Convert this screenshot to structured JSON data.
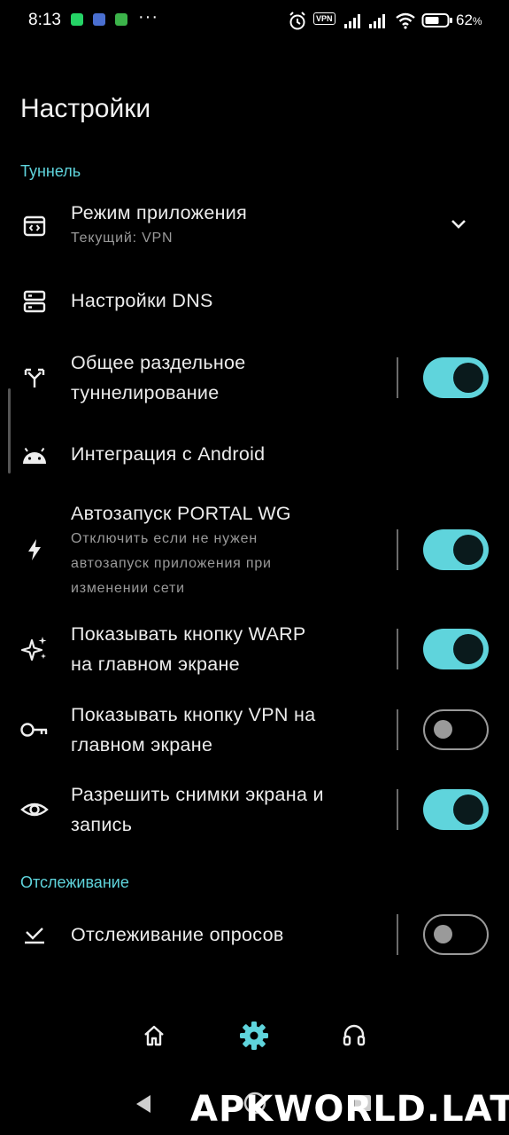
{
  "status_bar": {
    "time": "8:13",
    "battery_percent": "62",
    "battery_suffix": "%",
    "vpn_badge": "VPN",
    "more_dots": "···"
  },
  "page": {
    "title": "Настройки"
  },
  "sections": {
    "tunnel": {
      "header": "Туннель"
    },
    "tracking": {
      "header": "Отслеживание"
    }
  },
  "settings": {
    "app_mode": {
      "title": "Режим приложения",
      "subtitle": "Текущий: VPN",
      "icon": "app-window-icon"
    },
    "dns": {
      "title": "Настройки DNS",
      "icon": "dns-server-icon"
    },
    "split_tunnel": {
      "title_line1": "Общее раздельное",
      "title_line2": "туннелирование",
      "enabled": true,
      "icon": "split-arrows-icon"
    },
    "android": {
      "title": "Интеграция с Android",
      "icon": "android-icon"
    },
    "autostart": {
      "title": "Автозапуск PORTAL WG",
      "sub_line1": "Отключить если не нужен",
      "sub_line2": "автозапуск приложения при",
      "sub_line3": "изменении сети",
      "enabled": true,
      "icon": "bolt-icon"
    },
    "warp_button": {
      "title_line1": "Показывать кнопку WARP",
      "title_line2": "на главном экране",
      "enabled": true,
      "icon": "sparkle-icon"
    },
    "vpn_button": {
      "title_line1": "Показывать кнопку VPN на",
      "title_line2": "главном экране",
      "enabled": false,
      "icon": "key-icon"
    },
    "screenshots": {
      "title_line1": "Разрешить снимки экрана и",
      "title_line2": "запись",
      "enabled": true,
      "icon": "eye-icon"
    },
    "poll_tracking": {
      "title": "Отслеживание опросов",
      "enabled": false,
      "icon": "poll-check-icon"
    }
  },
  "bottom_nav": [
    {
      "icon": "home-icon",
      "active": false
    },
    {
      "icon": "gear-icon",
      "active": true
    },
    {
      "icon": "headset-icon",
      "active": false
    }
  ],
  "watermark": "APKWORLD.LAT",
  "colors": {
    "accent": "#5fd4dc",
    "background": "#000000",
    "subtitle": "#9a9a9a"
  }
}
